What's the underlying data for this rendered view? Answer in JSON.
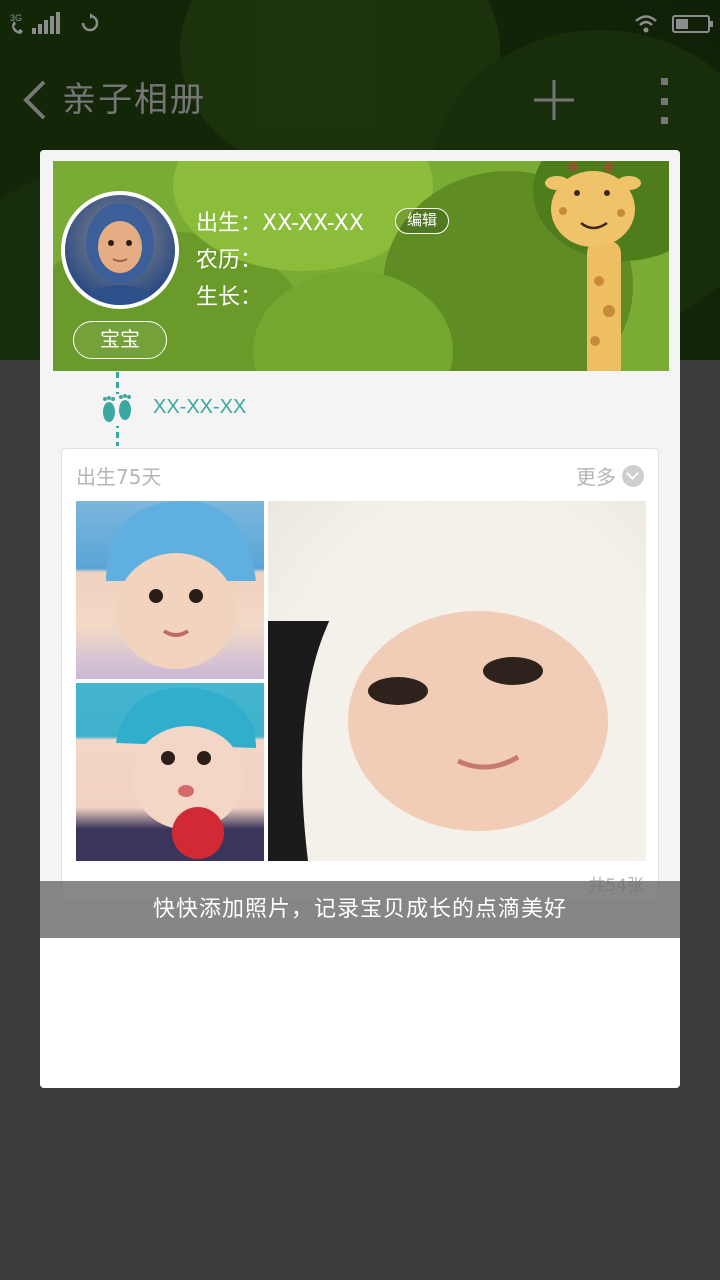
{
  "status_bar": {
    "network": "3G",
    "signal_bars": 4,
    "battery_level": 0.35,
    "icons": [
      "phone-icon",
      "sync-icon",
      "wifi-icon",
      "battery-icon"
    ]
  },
  "nav": {
    "back_icon": "chevron-left-icon",
    "title": "亲子相册",
    "add_icon": "plus-icon",
    "more_icon": "more-vertical-icon"
  },
  "profile": {
    "baby_name": "宝宝",
    "birth": "出生：XX-XX-XX",
    "lunar": "农历：",
    "growth": "生长：",
    "edit_label": "编辑"
  },
  "timeline": {
    "icon": "footprints-icon",
    "date": "XX-XX-XX"
  },
  "album_card": {
    "day_label": "出生75天",
    "more_label": "更多",
    "more_icon": "chevron-down-circle-icon",
    "count_label": "共54张",
    "photos": [
      "baby-photo-blue-hat",
      "baby-photo-teal-hat-red-ball",
      "baby-photo-white-hood"
    ]
  },
  "tip": {
    "text": "快快添加照片，记录宝贝成长的点滴美好"
  },
  "colors": {
    "header_green": "#2a4d12",
    "banner_green": "#7aab34",
    "accent_teal": "#3aa8a0",
    "overlay": "#6c6c6c"
  }
}
